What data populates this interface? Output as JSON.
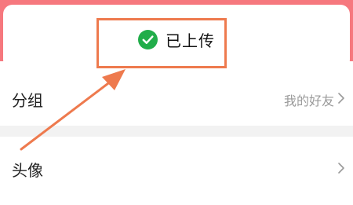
{
  "toast": {
    "message": "已上传",
    "icon": "check-circle-icon",
    "icon_color": "#21ad4a"
  },
  "list": {
    "group_label": "分组",
    "group_value": "我的好友",
    "avatar_label": "头像"
  },
  "colors": {
    "header": "#f6787e",
    "annotation": "#ee7a4e",
    "divider": "#f2f2f2"
  },
  "icons": {
    "chevron": "chevron-right-icon"
  }
}
